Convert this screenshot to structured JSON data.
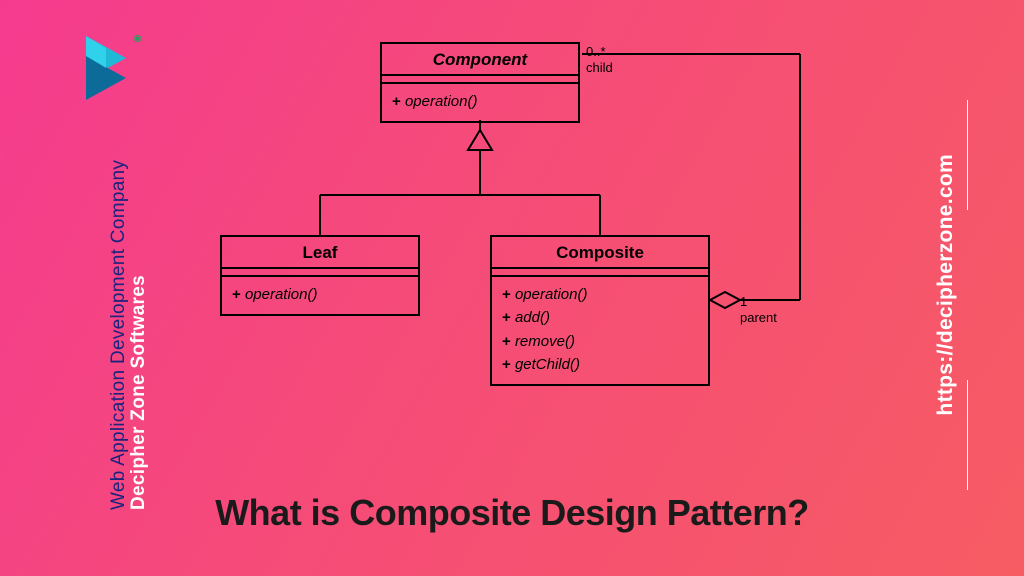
{
  "brand": {
    "company": "Decipher Zone Softwares",
    "tagline": "Web Application Development Company",
    "url": "https://decipherzone.com"
  },
  "title": "What is Composite Design Pattern?",
  "uml": {
    "component": {
      "name": "Component",
      "ops": [
        "operation()"
      ]
    },
    "leaf": {
      "name": "Leaf",
      "ops": [
        "operation()"
      ]
    },
    "composite": {
      "name": "Composite",
      "ops": [
        "operation()",
        "add()",
        "remove()",
        "getChild()"
      ]
    },
    "assoc": {
      "childMult": "0..*",
      "childRole": "child",
      "parentMult": "1",
      "parentRole": "parent"
    }
  }
}
